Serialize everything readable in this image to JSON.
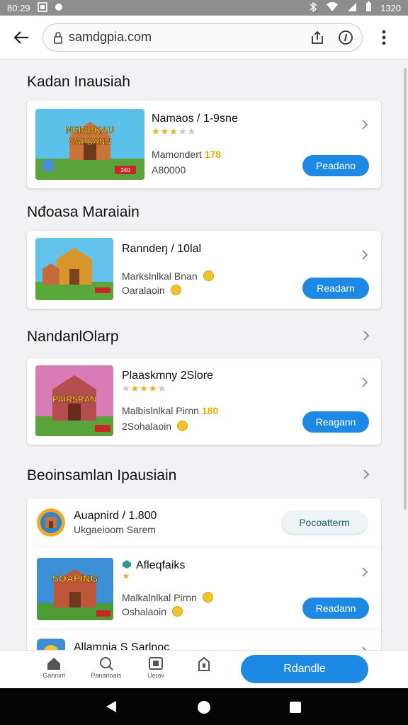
{
  "status_bar": {
    "time": "80:29",
    "battery": "1320"
  },
  "browser": {
    "url": "samdgpia.com"
  },
  "sections": [
    {
      "title": "Kadan Inausiah"
    },
    {
      "title": "Nđoasa Maraiain"
    },
    {
      "title": "NandanlOlarp"
    },
    {
      "title": "Beoinsamlan Ipausiain"
    }
  ],
  "cards": [
    {
      "thumb_text": "NEINBKAU CAPBANN",
      "name": "Namaos / 1-9sne",
      "stars": 3,
      "meta1": "Mamondert",
      "meta1_highlight": "178",
      "meta2": "A80000",
      "button": "Peadano",
      "thumb_badge": "240"
    },
    {
      "name": "Ranndeŋ / 10lal",
      "meta1": "Markslnlkal Bnan",
      "meta2": "Oaralaoin",
      "button": "Readarn"
    },
    {
      "thumb_text": "PAIRSRAN",
      "name": "Plaaskmny 2Slore",
      "stars": 3,
      "meta1": "Malbislnlkal Pirnn",
      "meta1_highlight": "180",
      "meta2": "2Sohalaoin",
      "button": "Reagann"
    }
  ],
  "list_card": {
    "rows": [
      {
        "name": "Auapnird / 1.800",
        "sub": "Ukgaeioom Sarem",
        "button": "Pocoatterm"
      },
      {
        "thumb_text": "SOAPING",
        "name": "Afleqfaiks",
        "meta1": "Malkalnlkal Pirnn",
        "meta2": "Oshalaoin",
        "button": "Readann"
      },
      {
        "name": "Allamnia S Sarlnoc"
      }
    ]
  },
  "bottom_nav": {
    "items": [
      {
        "label": "Gannirit",
        "icon": "home-icon"
      },
      {
        "label": "Pananoats",
        "icon": "search-icon"
      },
      {
        "label": "Uerav",
        "icon": "library-icon"
      },
      {
        "label": "",
        "icon": "bag-icon"
      }
    ],
    "cta": "Rdandle"
  },
  "colors": {
    "accent": "#1d89e4",
    "status_bar": "#8d8d8d",
    "star": "#e6b320"
  }
}
